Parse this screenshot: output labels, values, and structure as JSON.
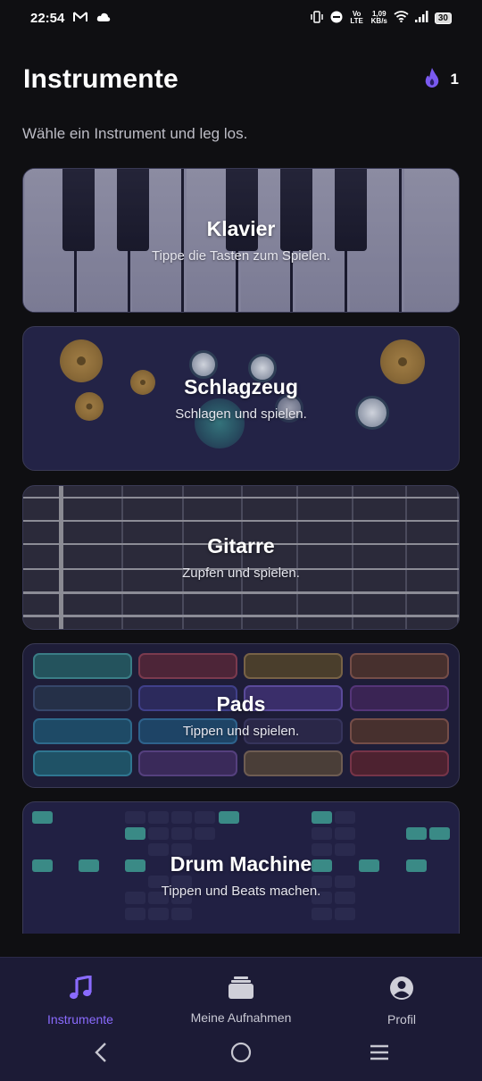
{
  "status_bar": {
    "time": "22:54",
    "net_speed": "1,09",
    "net_unit": "KB/s",
    "volte": "Vo LTE",
    "battery": "30"
  },
  "header": {
    "title": "Instrumente",
    "streak_count": "1",
    "subtitle": "Wähle ein Instrument und leg los."
  },
  "instruments": [
    {
      "title": "Klavier",
      "description": "Tippe die Tasten zum Spielen."
    },
    {
      "title": "Schlagzeug",
      "description": "Schlagen und spielen."
    },
    {
      "title": "Gitarre",
      "description": "Zupfen und spielen."
    },
    {
      "title": "Pads",
      "description": "Tippen und spielen."
    },
    {
      "title": "Drum Machine",
      "description": "Tippen und Beats machen."
    }
  ],
  "bottom_nav": [
    {
      "label": "Instrumente",
      "icon": "music-note-icon",
      "active": true
    },
    {
      "label": "Meine Aufnahmen",
      "icon": "recordings-stack-icon",
      "active": false
    },
    {
      "label": "Profil",
      "icon": "profile-icon",
      "active": false
    }
  ],
  "colors": {
    "accent": "#8a6bff",
    "background": "#0f0f12",
    "nav_background": "#1c1b36"
  }
}
